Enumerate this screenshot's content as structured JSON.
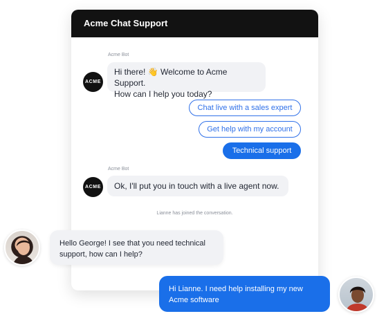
{
  "header": {
    "title": "Acme Chat Support"
  },
  "messages": {
    "bot_label_1": "Acme Bot",
    "bot_avatar_text": "ACME",
    "greeting_line1": "Hi there! 👋 Welcome to Acme Support.",
    "greeting_line2": "How can I help you today?",
    "bot_label_2": "Acme Bot",
    "bot_reply": "Ok, I'll put you in touch with a live agent now.",
    "system_notice": "Lianne has joined the conversation.",
    "agent_line1": "Hello George! I see that you need technical",
    "agent_line2": "support, how can I help?",
    "user_line1": "Hi Lianne. I need help installing my new",
    "user_line2": "Acme software"
  },
  "quick_replies": [
    {
      "label": "Chat live with a sales expert",
      "selected": false
    },
    {
      "label": "Get help with my account",
      "selected": false
    },
    {
      "label": "Technical support",
      "selected": true
    }
  ],
  "colors": {
    "accent": "#1a6fe9",
    "header_bg": "#121212",
    "bubble_bg": "#f1f2f5"
  }
}
